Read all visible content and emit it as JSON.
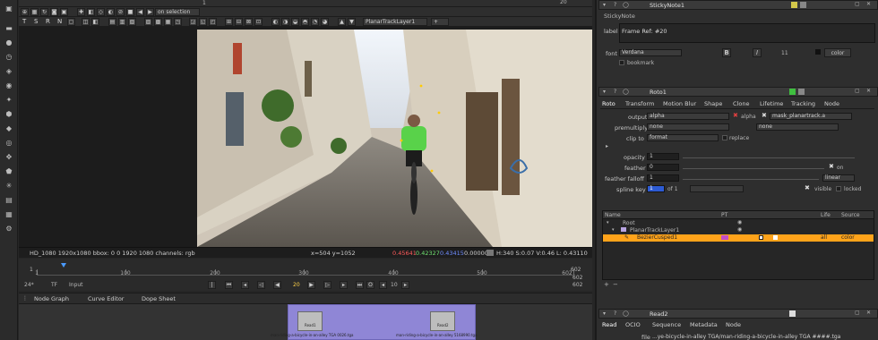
{
  "toolbar_top": {
    "frame_counter": "1",
    "frame_counter2": "1",
    "frame_right": "20",
    "on_selection": "on selection",
    "tool_letters": [
      "T",
      "S",
      "R",
      "N"
    ],
    "track_layer": "PlanarTrackLayer1",
    "cursor_label": "+"
  },
  "viewer": {
    "format_info": "HD_1080 1920x1080  bbox: 0 0 1920 1080 channels: rgb",
    "coords": "x=504 y=1052",
    "red": "0.45641",
    "green": "0.42327",
    "blue": "0.43415",
    "alpha": "0.00000",
    "hsv": "H:340 S:0.07 V:0.46   L: 0.43110",
    "colors": {
      "red": "#ff5b5b",
      "green": "#6fe06f",
      "blue": "#6e8cff"
    }
  },
  "timeline": {
    "start": "1",
    "end": "602",
    "ticks": [
      "1",
      "100",
      "200",
      "300",
      "400",
      "500",
      "602"
    ],
    "zoom": "24*",
    "tf": "TF",
    "input": "Input",
    "current_frame": "20",
    "step": "10",
    "end_right": "602",
    "end_right2": "602"
  },
  "ng_tabs": [
    "Node Graph",
    "Curve Editor",
    "Dope Sheet"
  ],
  "nodes": [
    {
      "label": "Read1",
      "caption": "man-riding-a-bicycle-in-an-alley TGA 0026.tga"
    },
    {
      "label": "Read2",
      "caption": "man-riding-a-bicycle-in-an-alley 5168990.tga"
    }
  ],
  "sticky": {
    "title": "StickyNote1",
    "tab": "StickyNote",
    "label_lbl": "label",
    "label_val": "Frame Ref: #20",
    "font_lbl": "font",
    "font_val": "Verdana",
    "font_size": "11",
    "color_lbl": "color",
    "bookmark": "bookmark"
  },
  "roto": {
    "title": "Roto1",
    "tabs": [
      "Roto",
      "Transform",
      "Motion Blur",
      "Shape",
      "Clone",
      "Lifetime",
      "Tracking",
      "Node"
    ],
    "output_lbl": "output",
    "output_val": "alpha",
    "alpha_chk": "alpha",
    "mask_val": "mask_planartrack.a",
    "premult_lbl": "premultiply",
    "premult_val": "none",
    "premult_val2": "none",
    "clip_lbl": "clip to",
    "clip_val": "format",
    "replace": "replace",
    "opacity_lbl": "opacity",
    "opacity_val": "1",
    "feather_lbl": "feather",
    "feather_val": "0",
    "on": "on",
    "falloff_lbl": "feather falloff",
    "falloff_val": "1",
    "falloff_mode": "linear",
    "splinekey_lbl": "spline key",
    "splinekey_val": "1",
    "splinekey_of": "of 1",
    "visible": "visible",
    "locked": "locked",
    "tree_headers": [
      "Name",
      "PT",
      "Life",
      "Source"
    ],
    "tree_rows": [
      {
        "name": "Root",
        "life": "",
        "source": ""
      },
      {
        "name": "PlanarTrackLayer1",
        "life": "",
        "source": ""
      },
      {
        "name": "BezierCusped1",
        "life": "all",
        "source": "color"
      }
    ],
    "selected_color": "#ffa31a"
  },
  "read2": {
    "title": "Read2",
    "tabs": [
      "Read",
      "OCIO",
      "Sequence",
      "Metadata",
      "Node"
    ],
    "file_lbl": "file",
    "file_val": "...ye-bicycle-in-alley TGA/man-riding-a-bicycle-in-alley TGA ####.tga"
  }
}
